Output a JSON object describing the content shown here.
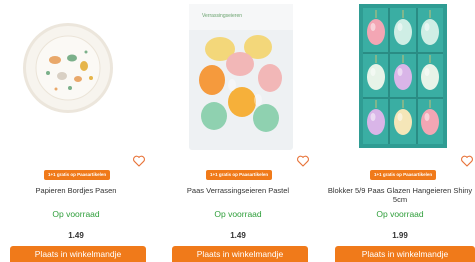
{
  "products": [
    {
      "badge": "1+1 gratis op Paasartikelen",
      "name": "Papieren Bordjes Pasen",
      "availability": "Op voorraad",
      "price": "1.49",
      "cart_label": "Plaats in winkelmandje"
    },
    {
      "badge": "1+1 gratis op Paasartikelen",
      "name": "Paas Verrassingseieren Pastel",
      "availability": "Op voorraad",
      "price": "1.49",
      "cart_label": "Plaats in winkelmandje"
    },
    {
      "badge": "1+1 gratis op Paasartikelen",
      "name": "Blokker 5/9 Paas Glazen Hangeieren Shiny 5cm",
      "availability": "Op voorraad",
      "price": "1.99",
      "cart_label": "Plaats in winkelmandje"
    }
  ],
  "package_label": "Verrassingseieren",
  "colors": {
    "accent": "#f07a1a",
    "stock_green": "#2e9e3a",
    "heart": "#e8743a"
  },
  "icons": {
    "favorite": "heart-outline-icon"
  }
}
